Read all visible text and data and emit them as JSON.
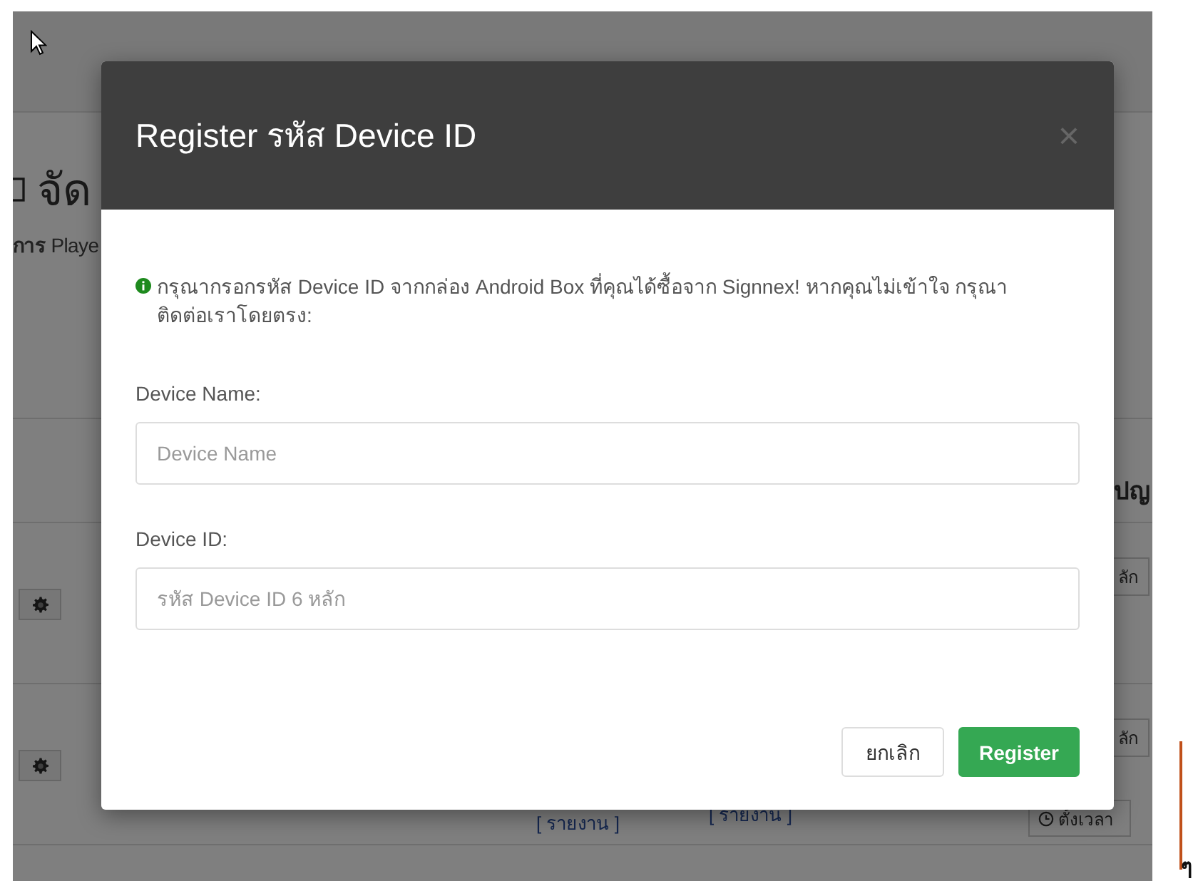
{
  "background": {
    "title": "จัด",
    "subtitle": "**การ** Playe",
    "table": {
      "columns": [
        {
          "label": "ปญ"
        }
      ],
      "rows": [
        {
          "action": "ลัก"
        },
        {
          "action": "ลัก",
          "links": [
            "[ รายงาน ]",
            "[ รายงาน ]"
          ],
          "schedule": "ตั้งเวลา"
        }
      ]
    }
  },
  "side_text": "ๆ",
  "modal": {
    "title": "Register **รหัส** Device ID",
    "close": "×",
    "info": "กรุณากรอกรหัส Device ID จากกล่อง Android Box ที่คุณได้ซื้อจาก Signnex! หากคุณไม่เข้าใจ กรุณาติดต่อเราโดยตรง:",
    "fields": [
      {
        "label": "Device Name:",
        "placeholder": "Device Name"
      },
      {
        "label": "Device ID:",
        "placeholder": "รหัส Device ID 6 หลัก"
      }
    ],
    "buttons": [
      {
        "kind": "default",
        "label": "ยกเลิก"
      },
      {
        "kind": "primary",
        "label": "Register"
      }
    ]
  }
}
